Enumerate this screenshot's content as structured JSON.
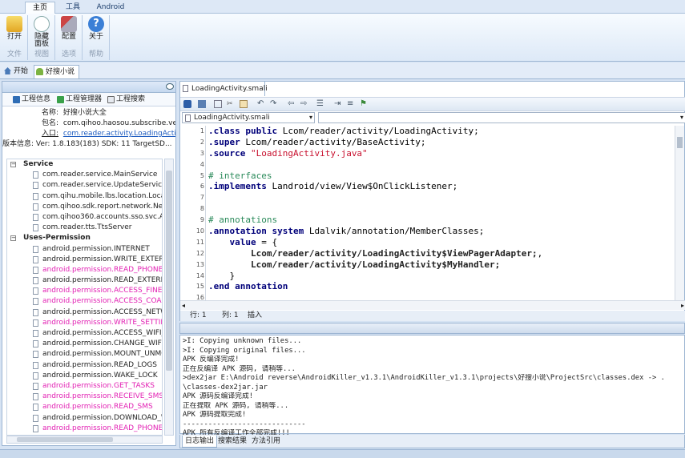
{
  "ribbon": {
    "tabs": [
      "主页",
      "工具",
      "Android"
    ],
    "buttons": {
      "open": "打开",
      "hide": "隐藏面板",
      "config": "配置",
      "about": "关于"
    },
    "groups": {
      "file": "文件",
      "view": "视图",
      "options": "选项",
      "help": "帮助"
    }
  },
  "doc_tabs": {
    "start": "开始",
    "project": "好搜小说"
  },
  "left": {
    "tabs": [
      "工程信息",
      "工程管理器",
      "工程搜索"
    ],
    "info": {
      "name_label": "名称:",
      "name_value": "好搜小说大全",
      "package_label": "包名:",
      "package_value": "com.qihoo.haosou.subscribe.vert...",
      "entry_label": "入口:",
      "entry_value": "com.reader.activity.LoadingActivi...",
      "version_label": "版本信息:",
      "version_value": "Ver: 1.8.183(183) SDK: 11 TargetSD..."
    },
    "tree": [
      {
        "type": "cat",
        "label": "Service",
        "pink": false
      },
      {
        "type": "item",
        "label": "com.reader.service.MainService",
        "pink": false
      },
      {
        "type": "item",
        "label": "com.reader.service.UpdateService",
        "pink": false
      },
      {
        "type": "item",
        "label": "com.qihu.mobile.lbs.location.Location",
        "pink": false
      },
      {
        "type": "item",
        "label": "com.qihoo.sdk.report.network.Netwo",
        "pink": false
      },
      {
        "type": "item",
        "label": "com.qihoo360.accounts.sso.svc.Accc",
        "pink": false
      },
      {
        "type": "item",
        "label": "com.reader.tts.TtsServer",
        "pink": false
      },
      {
        "type": "cat",
        "label": "Uses-Permission",
        "pink": false
      },
      {
        "type": "item",
        "label": "android.permission.INTERNET",
        "pink": false
      },
      {
        "type": "item",
        "label": "android.permission.WRITE_EXTERNAL",
        "pink": false
      },
      {
        "type": "item",
        "label": "android.permission.READ_PHONE_ST",
        "pink": true
      },
      {
        "type": "item",
        "label": "android.permission.READ_EXTERNAL_",
        "pink": false
      },
      {
        "type": "item",
        "label": "android.permission.ACCESS_FINE_LO",
        "pink": true
      },
      {
        "type": "item",
        "label": "android.permission.ACCESS_COARSE",
        "pink": true
      },
      {
        "type": "item",
        "label": "android.permission.ACCESS_NETWO",
        "pink": false
      },
      {
        "type": "item",
        "label": "android.permission.WRITE_SETTINGS",
        "pink": true
      },
      {
        "type": "item",
        "label": "android.permission.ACCESS_WIFI_ST",
        "pink": false
      },
      {
        "type": "item",
        "label": "android.permission.CHANGE_WIFI_ST",
        "pink": false
      },
      {
        "type": "item",
        "label": "android.permission.MOUNT_UNMOU",
        "pink": false
      },
      {
        "type": "item",
        "label": "android.permission.READ_LOGS",
        "pink": false
      },
      {
        "type": "item",
        "label": "android.permission.WAKE_LOCK",
        "pink": false
      },
      {
        "type": "item",
        "label": "android.permission.GET_TASKS",
        "pink": true
      },
      {
        "type": "item",
        "label": "android.permission.RECEIVE_SMS",
        "pink": true
      },
      {
        "type": "item",
        "label": "android.permission.READ_SMS",
        "pink": true
      },
      {
        "type": "item",
        "label": "android.permission.DOWNLOAD_WI",
        "pink": false
      },
      {
        "type": "item",
        "label": "android.permission.READ_PHONE_ST",
        "pink": true
      }
    ]
  },
  "editor": {
    "tab": "LoadingActivity.smali",
    "combo": "LoadingActivity.smali",
    "lines": [
      {
        "n": "1",
        "segs": [
          [
            "kw",
            ".class public "
          ],
          [
            "cls",
            "Lcom/reader/activity/LoadingActivity;"
          ]
        ]
      },
      {
        "n": "2",
        "segs": [
          [
            "kw",
            ".super "
          ],
          [
            "cls",
            "Lcom/reader/activity/BaseActivity;"
          ]
        ]
      },
      {
        "n": "3",
        "segs": [
          [
            "kw",
            ".source "
          ],
          [
            "str",
            "\"LoadingActivity.java\""
          ]
        ]
      },
      {
        "n": "4",
        "segs": []
      },
      {
        "n": "5",
        "segs": [
          [
            "cm",
            "# interfaces"
          ]
        ]
      },
      {
        "n": "6",
        "segs": [
          [
            "kw",
            ".implements "
          ],
          [
            "cls",
            "Landroid/view/View$OnClickListener;"
          ]
        ]
      },
      {
        "n": "7",
        "segs": []
      },
      {
        "n": "8",
        "segs": []
      },
      {
        "n": "9",
        "segs": [
          [
            "cm",
            "# annotations"
          ]
        ]
      },
      {
        "n": "10",
        "segs": [
          [
            "kw",
            ".annotation system "
          ],
          [
            "cls",
            "Ldalvik/annotation/MemberClasses;"
          ]
        ]
      },
      {
        "n": "11",
        "segs": [
          [
            "kw",
            "    value"
          ],
          [
            "cls",
            " = {"
          ]
        ]
      },
      {
        "n": "12",
        "segs": [
          [
            "bold",
            "        Lcom/reader/activity/LoadingActivity$ViewPagerAdapter;"
          ],
          [
            "cls",
            ","
          ]
        ]
      },
      {
        "n": "13",
        "segs": [
          [
            "bold",
            "        Lcom/reader/activity/LoadingActivity$MyHandler;"
          ]
        ]
      },
      {
        "n": "14",
        "segs": [
          [
            "cls",
            "    }"
          ]
        ]
      },
      {
        "n": "15",
        "segs": [
          [
            "kw",
            ".end annotation"
          ]
        ]
      },
      {
        "n": "16",
        "segs": []
      }
    ],
    "status": {
      "row_label": "行: 1",
      "col_label": "列: 1",
      "mode": "插入"
    }
  },
  "output": {
    "lines": [
      ">I: Copying unknown files...",
      ">I: Copying original files...",
      "APK 反编译完成!",
      "正在反编译 APK 源码, 请稍等...",
      ">dex2jar E:\\Android reverse\\AndroidKiller_v1.3.1\\AndroidKiller_v1.3.1\\projects\\好搜小说\\ProjectSrc\\classes.dex -> .",
      "\\classes-dex2jar.jar",
      "APK 源码反编译完成!",
      "正在提取 APK 源码, 请稍等...",
      "APK 源码提取完成!",
      "-----------------------------",
      "APK 所有反编译工作全部完成!!!"
    ],
    "tabs": [
      "日志输出",
      "搜索结果",
      "方法引用"
    ]
  },
  "colors": {
    "pink": "#e21fb3",
    "keyword": "#00007a",
    "string": "#c8102e",
    "comment": "#2a8a5a",
    "link": "#1d5bbf"
  }
}
